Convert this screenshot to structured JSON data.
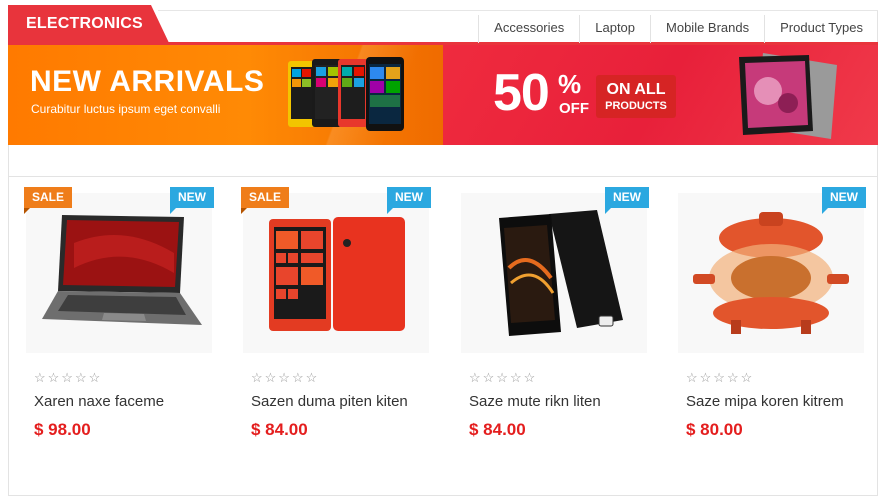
{
  "header": {
    "category_title": "ELECTRONICS",
    "nav": [
      "Accessories",
      "Laptop",
      "Mobile Brands",
      "Product Types"
    ]
  },
  "banner_left": {
    "title": "NEW ARRIVALS",
    "subtitle": "Curabitur luctus ipsum eget convalli"
  },
  "banner_right": {
    "percent": "50",
    "percent_sign": "%",
    "off": "OFF",
    "on_all": "ON ALL",
    "products": "PRODUCTS"
  },
  "colors": {
    "brand_red": "#e8343c",
    "orange": "#ff7a00",
    "sale": "#ef7d1a",
    "new": "#2ba8e0",
    "price": "#e41e1e"
  },
  "products": [
    {
      "name": "Xaren naxe faceme",
      "price": "$ 98.00",
      "sale": "SALE",
      "new": "NEW",
      "stars": "☆☆☆☆☆"
    },
    {
      "name": "Sazen duma piten kiten",
      "price": "$ 84.00",
      "sale": "SALE",
      "new": "NEW",
      "stars": "☆☆☆☆☆"
    },
    {
      "name": "Saze mute rikn liten",
      "price": "$ 84.00",
      "new": "NEW",
      "stars": "☆☆☆☆☆"
    },
    {
      "name": "Saze mipa koren kitrem",
      "price": "$ 80.00",
      "new": "NEW",
      "stars": "☆☆☆☆☆"
    }
  ]
}
